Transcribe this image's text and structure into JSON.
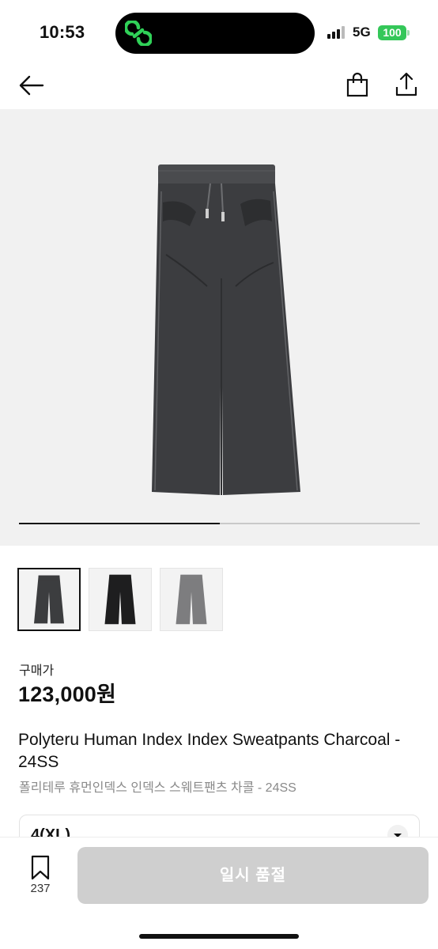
{
  "status_bar": {
    "time": "10:53",
    "network": "5G",
    "battery": "100"
  },
  "header": {
    "icons": [
      "back-arrow-icon",
      "shopping-bag-icon",
      "share-icon"
    ]
  },
  "gallery": {
    "main_image": "charcoal-sweatpants-photo",
    "progress": 0.5,
    "thumbnails": [
      {
        "name": "charcoal-pants",
        "color": "#3c3d3f",
        "selected": true
      },
      {
        "name": "black-pants",
        "color": "#1e1e1f",
        "selected": false
      },
      {
        "name": "grey-pants",
        "color": "#7d7d7f",
        "selected": false
      }
    ]
  },
  "product": {
    "price_label": "구매가",
    "price": "123,000원",
    "title": "Polyteru Human Index Index Sweatpants Charcoal - 24SS",
    "subtitle": "폴리테루 휴먼인덱스 인덱스 스웨트팬츠 차콜 - 24SS",
    "size": "4(XL)"
  },
  "bottom_bar": {
    "wish_count": "237",
    "cta_label": "일시 품절"
  },
  "colors": {
    "accent_battery": "#34c759",
    "brand_logo": "#30d158",
    "cta_disabled": "#cfcfcf"
  }
}
